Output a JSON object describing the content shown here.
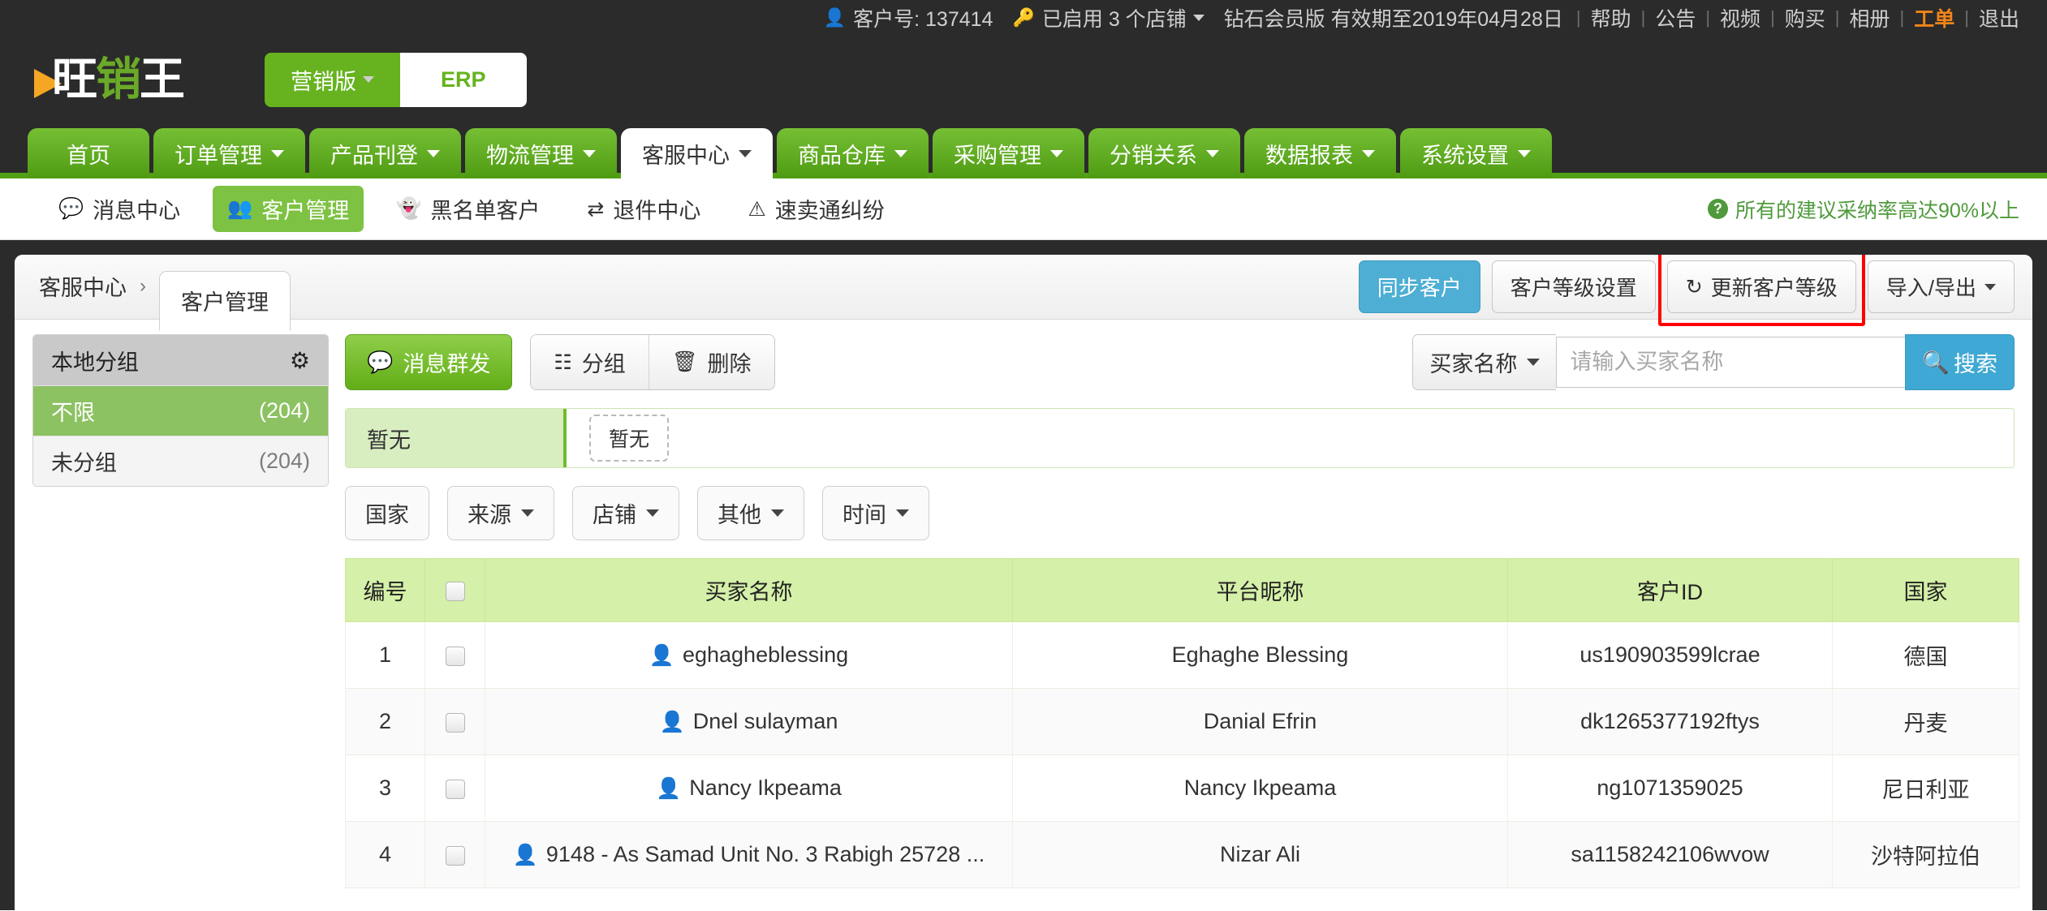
{
  "topbar": {
    "user_icon": "user-icon",
    "account_label": "客户号: 137414",
    "shop_icon": "key-icon",
    "shops_label": "已启用 3 个店铺",
    "membership": "钻石会员版 有效期至2019年04月28日",
    "links": [
      "帮助",
      "公告",
      "视频",
      "购买",
      "相册"
    ],
    "hot_link": "工单",
    "logout": "退出",
    "hot_color": "#f08519"
  },
  "brand": {
    "logo_text_1": "旺",
    "logo_text_2": "销",
    "logo_text_3": "王",
    "version_button": "营销版",
    "erp_button": "ERP",
    "green": "#66b31f",
    "orange": "#f5a623"
  },
  "mainnav": {
    "items": [
      {
        "label": "首页",
        "has_caret": false,
        "active": false
      },
      {
        "label": "订单管理",
        "has_caret": true,
        "active": false
      },
      {
        "label": "产品刊登",
        "has_caret": true,
        "active": false
      },
      {
        "label": "物流管理",
        "has_caret": true,
        "active": false
      },
      {
        "label": "客服中心",
        "has_caret": true,
        "active": true
      },
      {
        "label": "商品仓库",
        "has_caret": true,
        "active": false
      },
      {
        "label": "采购管理",
        "has_caret": true,
        "active": false
      },
      {
        "label": "分销关系",
        "has_caret": true,
        "active": false
      },
      {
        "label": "数据报表",
        "has_caret": true,
        "active": false
      },
      {
        "label": "系统设置",
        "has_caret": true,
        "active": false
      }
    ]
  },
  "subnav": {
    "items": [
      {
        "label": "消息中心",
        "icon": "comment-icon",
        "glyph": "💬",
        "active": false
      },
      {
        "label": "客户管理",
        "icon": "users-icon",
        "glyph": "👥",
        "active": true
      },
      {
        "label": "黑名单客户",
        "icon": "ghost-icon",
        "glyph": "👻",
        "active": false
      },
      {
        "label": "退件中心",
        "icon": "exchange-icon",
        "glyph": "⇄",
        "active": false
      },
      {
        "label": "速卖通纠纷",
        "icon": "warning-icon",
        "glyph": "⚠",
        "active": false
      }
    ],
    "notice": "所有的建议采纳率高达90%以上",
    "notice_icon": "question-circle-icon",
    "notice_color": "#4f9a3c"
  },
  "crumb": {
    "parent": "客服中心",
    "separator": "›",
    "current_tab": "客户管理",
    "actions": [
      {
        "label": "同步客户",
        "style": "primary",
        "icon": null,
        "caret": false
      },
      {
        "label": "客户等级设置",
        "style": "plain",
        "icon": null,
        "caret": false
      },
      {
        "label": "更新客户等级",
        "style": "plain",
        "icon": "refresh-icon",
        "caret": false,
        "highlighted": true
      },
      {
        "label": "导入/导出",
        "style": "plain",
        "icon": null,
        "caret": true
      }
    ],
    "highlight_color": "#ff0000"
  },
  "sidebar": {
    "title": "本地分组",
    "gear_icon": "gear-icon",
    "items": [
      {
        "label": "不限",
        "count": "(204)",
        "active": true
      },
      {
        "label": "未分组",
        "count": "(204)",
        "active": false
      }
    ]
  },
  "toolbar": {
    "broadcast_label": "消息群发",
    "broadcast_icon": "comment-icon",
    "group_label": "分组",
    "group_icon": "sitemap-icon",
    "delete_label": "删除",
    "delete_icon": "trash-icon"
  },
  "search": {
    "field_label": "买家名称",
    "placeholder": "请输入买家名称",
    "value": "",
    "button_label": "搜索",
    "button_icon": "search-icon",
    "button_color": "#3fa8d4"
  },
  "strip": {
    "lead_label": "暂无",
    "chip_label": "暂无"
  },
  "filters": [
    {
      "label": "国家",
      "caret": false
    },
    {
      "label": "来源",
      "caret": true
    },
    {
      "label": "店铺",
      "caret": true
    },
    {
      "label": "其他",
      "caret": true
    },
    {
      "label": "时间",
      "caret": true
    }
  ],
  "table": {
    "headers": [
      "编号",
      "",
      "买家名称",
      "平台昵称",
      "客户ID",
      "国家"
    ],
    "select_all_icon": "checkbox-icon",
    "rows": [
      {
        "num": "1",
        "buyer": "eghagheblessing",
        "nickname": "Eghaghe Blessing",
        "customer_id": "us190903599lcrae",
        "country": "德国"
      },
      {
        "num": "2",
        "buyer": "Dnel sulayman",
        "nickname": "Danial Efrin",
        "customer_id": "dk1265377192ftys",
        "country": "丹麦"
      },
      {
        "num": "3",
        "buyer": "Nancy Ikpeama",
        "nickname": "Nancy Ikpeama",
        "customer_id": "ng1071359025",
        "country": "尼日利亚"
      },
      {
        "num": "4",
        "buyer": "9148 - As Samad Unit No. 3 Rabigh 25728 ...",
        "nickname": "Nizar Ali",
        "customer_id": "sa1158242106wvow",
        "country": "沙特阿拉伯"
      }
    ]
  }
}
